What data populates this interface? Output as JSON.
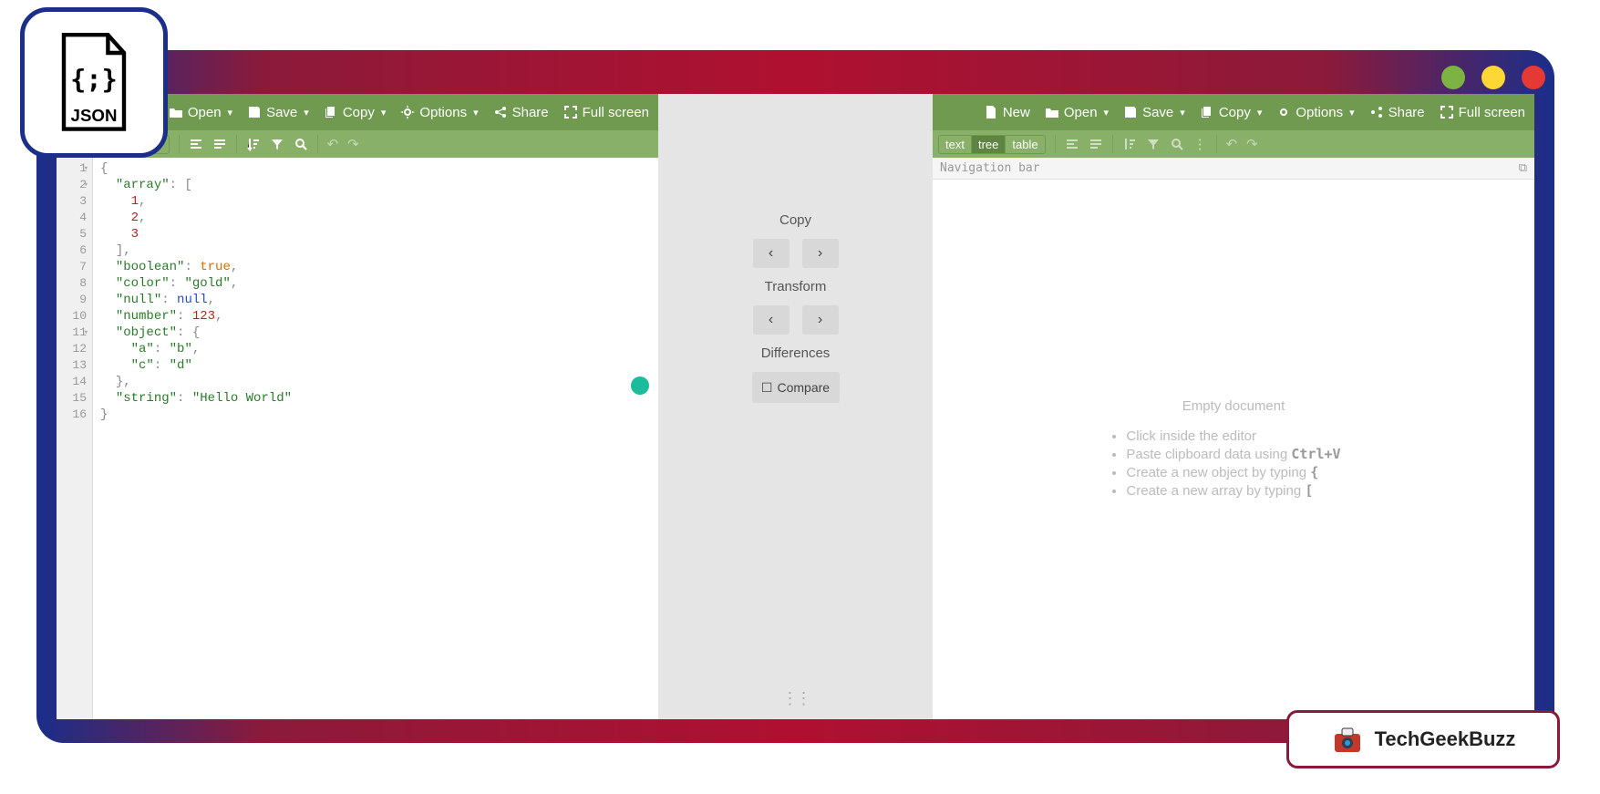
{
  "traffic_colors": {
    "green": "#7cb342",
    "yellow": "#fdd835",
    "red": "#e53935"
  },
  "topbar": {
    "new": "New",
    "open": "Open",
    "save": "Save",
    "copy": "Copy",
    "options": "Options",
    "share": "Share",
    "fullscreen": "Full screen"
  },
  "modes": {
    "text": "text",
    "tree": "tree",
    "table": "table"
  },
  "middle": {
    "copy": "Copy",
    "transform": "Transform",
    "differences": "Differences",
    "compare": "Compare"
  },
  "right": {
    "nav": "Navigation bar",
    "empty_title": "Empty document",
    "hints": [
      "Click inside the editor",
      "Paste clipboard data using ",
      "Create a new object by typing ",
      "Create a new array by typing "
    ],
    "hint_bold": [
      "",
      "Ctrl+V",
      "{",
      "["
    ]
  },
  "brand": "TechGeekBuzz",
  "code_lines": [
    {
      "n": 1,
      "fold": true,
      "t": [
        [
          "p",
          "{"
        ]
      ]
    },
    {
      "n": 2,
      "fold": true,
      "t": [
        [
          "w",
          "  "
        ],
        [
          "k",
          "\"array\""
        ],
        [
          "p",
          ": ["
        ]
      ]
    },
    {
      "n": 3,
      "fold": false,
      "t": [
        [
          "w",
          "    "
        ],
        [
          "n",
          "1"
        ],
        [
          "p",
          ","
        ]
      ]
    },
    {
      "n": 4,
      "fold": false,
      "t": [
        [
          "w",
          "    "
        ],
        [
          "n",
          "2"
        ],
        [
          "p",
          ","
        ]
      ]
    },
    {
      "n": 5,
      "fold": false,
      "t": [
        [
          "w",
          "    "
        ],
        [
          "n",
          "3"
        ]
      ]
    },
    {
      "n": 6,
      "fold": false,
      "t": [
        [
          "w",
          "  "
        ],
        [
          "p",
          "],"
        ]
      ]
    },
    {
      "n": 7,
      "fold": false,
      "t": [
        [
          "w",
          "  "
        ],
        [
          "k",
          "\"boolean\""
        ],
        [
          "p",
          ": "
        ],
        [
          "b",
          "true"
        ],
        [
          "p",
          ","
        ]
      ]
    },
    {
      "n": 8,
      "fold": false,
      "t": [
        [
          "w",
          "  "
        ],
        [
          "k",
          "\"color\""
        ],
        [
          "p",
          ": "
        ],
        [
          "s",
          "\"gold\""
        ],
        [
          "p",
          ","
        ]
      ]
    },
    {
      "n": 9,
      "fold": false,
      "t": [
        [
          "w",
          "  "
        ],
        [
          "k",
          "\"null\""
        ],
        [
          "p",
          ": "
        ],
        [
          "nu",
          "null"
        ],
        [
          "p",
          ","
        ]
      ]
    },
    {
      "n": 10,
      "fold": false,
      "t": [
        [
          "w",
          "  "
        ],
        [
          "k",
          "\"number\""
        ],
        [
          "p",
          ": "
        ],
        [
          "n",
          "123"
        ],
        [
          "p",
          ","
        ]
      ]
    },
    {
      "n": 11,
      "fold": true,
      "t": [
        [
          "w",
          "  "
        ],
        [
          "k",
          "\"object\""
        ],
        [
          "p",
          ": {"
        ]
      ]
    },
    {
      "n": 12,
      "fold": false,
      "t": [
        [
          "w",
          "    "
        ],
        [
          "k",
          "\"a\""
        ],
        [
          "p",
          ": "
        ],
        [
          "s",
          "\"b\""
        ],
        [
          "p",
          ","
        ]
      ]
    },
    {
      "n": 13,
      "fold": false,
      "t": [
        [
          "w",
          "    "
        ],
        [
          "k",
          "\"c\""
        ],
        [
          "p",
          ": "
        ],
        [
          "s",
          "\"d\""
        ]
      ]
    },
    {
      "n": 14,
      "fold": false,
      "t": [
        [
          "w",
          "  "
        ],
        [
          "p",
          "},"
        ]
      ]
    },
    {
      "n": 15,
      "fold": false,
      "t": [
        [
          "w",
          "  "
        ],
        [
          "k",
          "\"string\""
        ],
        [
          "p",
          ": "
        ],
        [
          "s",
          "\"Hello World\""
        ]
      ]
    },
    {
      "n": 16,
      "fold": false,
      "t": [
        [
          "p",
          "}"
        ]
      ]
    }
  ]
}
